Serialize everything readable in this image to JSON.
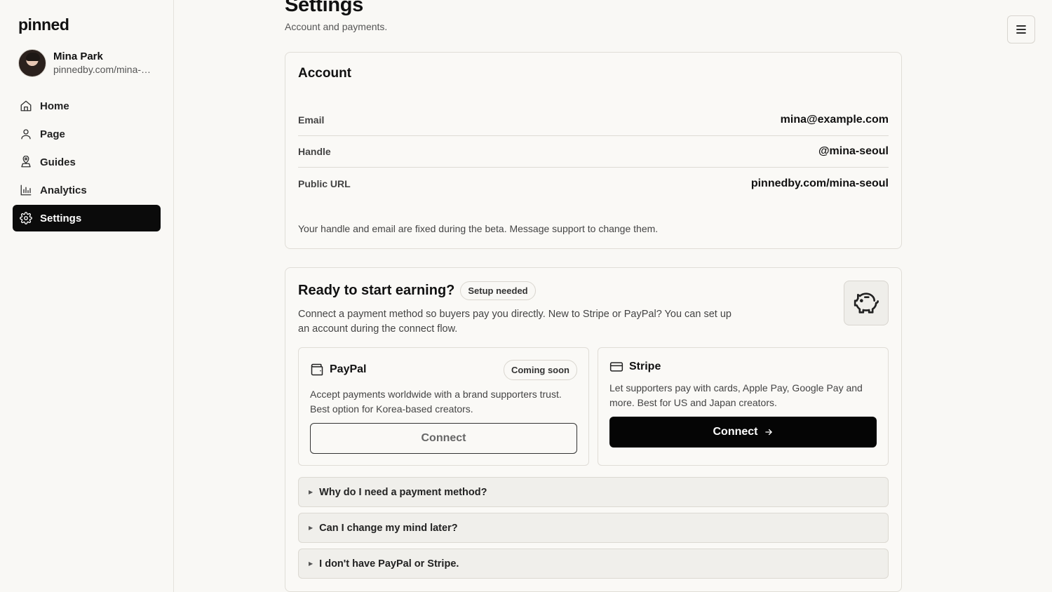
{
  "app": {
    "logo": "pinned"
  },
  "profile": {
    "name": "Mina Park",
    "url": "pinnedby.com/mina-seoul"
  },
  "sidebar": {
    "items": [
      {
        "label": "Home",
        "icon": "home-icon",
        "active": false
      },
      {
        "label": "Page",
        "icon": "user-icon",
        "active": false
      },
      {
        "label": "Guides",
        "icon": "map-pin-icon",
        "active": false
      },
      {
        "label": "Analytics",
        "icon": "bar-chart-icon",
        "active": false
      },
      {
        "label": "Settings",
        "icon": "gear-icon",
        "active": true
      }
    ]
  },
  "header": {
    "title": "Settings",
    "subtitle": "Account and payments."
  },
  "account": {
    "title": "Account",
    "rows": [
      {
        "label": "Email",
        "value": "mina@example.com"
      },
      {
        "label": "Handle",
        "value": "@mina-seoul"
      },
      {
        "label": "Public URL",
        "value": "pinnedby.com/mina-seoul"
      }
    ],
    "note": "Your handle and email are fixed during the beta. Message support to change them."
  },
  "earning": {
    "title": "Ready to start earning?",
    "badge": "Setup needed",
    "description": "Connect a payment method so buyers pay you directly. New to Stripe or PayPal? You can set up an account during the connect flow.",
    "icon": "piggy-bank-icon",
    "paypal": {
      "name": "PayPal",
      "badge": "Coming soon",
      "description": "Accept payments worldwide with a brand supporters trust. Best option for Korea-based creators.",
      "button": "Connect",
      "icon": "wallet-icon"
    },
    "stripe": {
      "name": "Stripe",
      "description": "Let supporters pay with cards, Apple Pay, Google Pay and more. Best for US and Japan creators.",
      "button": "Connect",
      "icon": "credit-card-icon"
    },
    "faqs": [
      "Why do I need a payment method?",
      "Can I change my mind later?",
      "I don't have PayPal or Stripe."
    ]
  },
  "colors": {
    "accent": "#0b0b0b",
    "background": "#f9f8f5",
    "border": "#e0ddd7"
  }
}
